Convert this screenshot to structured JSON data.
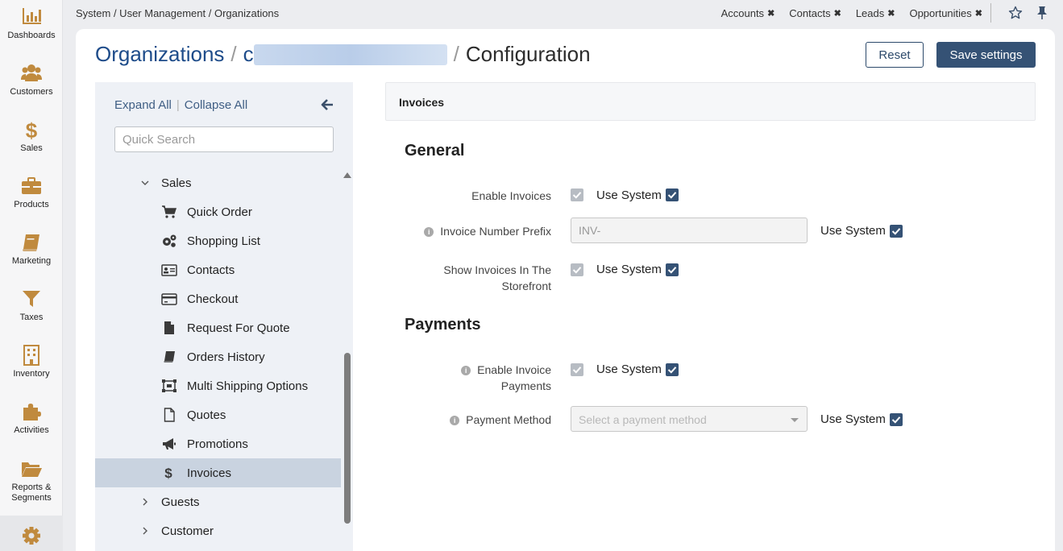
{
  "nav": [
    {
      "label": "Dashboards",
      "icon": "chart-bar-icon"
    },
    {
      "label": "Customers",
      "icon": "users-icon"
    },
    {
      "label": "Sales",
      "icon": "dollar-icon"
    },
    {
      "label": "Products",
      "icon": "briefcase-icon"
    },
    {
      "label": "Marketing",
      "icon": "book-icon"
    },
    {
      "label": "Taxes",
      "icon": "filter-icon"
    },
    {
      "label": "Inventory",
      "icon": "building-icon"
    },
    {
      "label": "Activities",
      "icon": "puzzle-icon"
    },
    {
      "label": "Reports &",
      "label2": "Segments",
      "icon": "folder-icon"
    },
    {
      "label": "",
      "icon": "gear-icon"
    }
  ],
  "breadcrumb": "System / User Management / Organizations",
  "shortcuts": [
    "Accounts",
    "Contacts",
    "Leads",
    "Opportunities"
  ],
  "shortcut_close": "✖",
  "title": {
    "link": "Organizations",
    "sep": "/",
    "partial": "c",
    "current": "Configuration"
  },
  "buttons": {
    "reset": "Reset",
    "save": "Save settings"
  },
  "tree": {
    "expand_all": "Expand All",
    "pipe": "|",
    "collapse_all": "Collapse All",
    "search_placeholder": "Quick Search",
    "parent": "Sales",
    "children": [
      {
        "label": "Quick Order",
        "icon": "cart-icon"
      },
      {
        "label": "Shopping List",
        "icon": "cogs-icon"
      },
      {
        "label": "Contacts",
        "icon": "address-card-icon"
      },
      {
        "label": "Checkout",
        "icon": "credit-card-icon"
      },
      {
        "label": "Request For Quote",
        "icon": "file-icon"
      },
      {
        "label": "Orders History",
        "icon": "book-icon"
      },
      {
        "label": "Multi Shipping Options",
        "icon": "object-group-icon"
      },
      {
        "label": "Quotes",
        "icon": "file-outline-icon"
      },
      {
        "label": "Promotions",
        "icon": "bullhorn-icon"
      },
      {
        "label": "Invoices",
        "icon": "dollar-icon"
      }
    ],
    "siblings": [
      "Guests",
      "Customer"
    ]
  },
  "section": "Invoices",
  "groups": {
    "general": "General",
    "payments": "Payments"
  },
  "fields": {
    "enable_invoices": "Enable Invoices",
    "invoice_number_prefix": "Invoice Number Prefix",
    "invoice_prefix_value": "INV-",
    "show_invoices_line1": "Show Invoices In The",
    "show_invoices_line2": "Storefront",
    "enable_payments_line1": "Enable Invoice",
    "enable_payments_line2": "Payments",
    "payment_method": "Payment Method",
    "payment_method_placeholder": "Select a payment method",
    "use_system": "Use System"
  },
  "info_glyph": "i"
}
